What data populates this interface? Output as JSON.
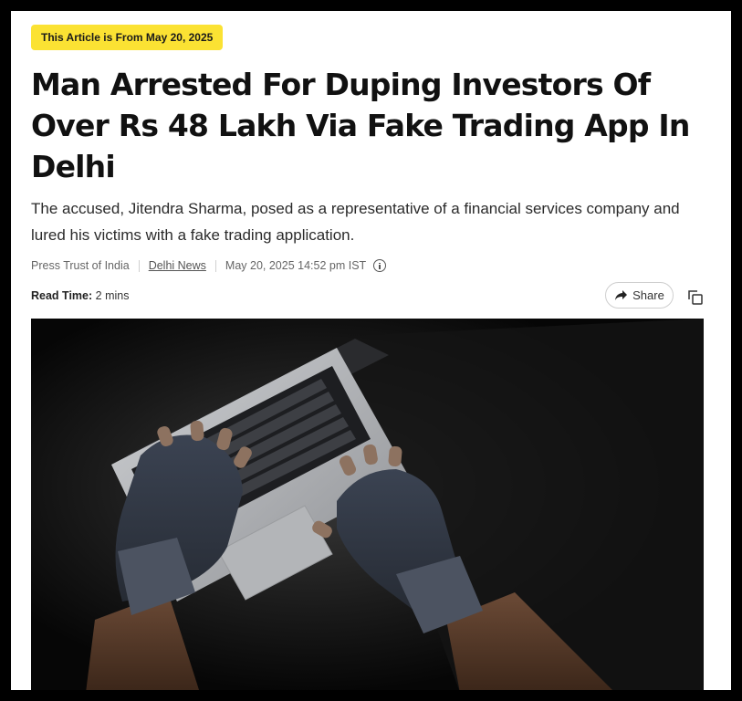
{
  "article": {
    "date_badge": "This Article is From May 20, 2025",
    "headline": "Man Arrested For Duping Investors Of Over Rs 48 Lakh Via Fake Trading App In Delhi",
    "summary": "The accused, Jitendra Sharma, posed as a representative of a financial services company and lured his victims with a fake trading application.",
    "meta": {
      "source": "Press Trust of India",
      "category": "Delhi News",
      "datetime": "May 20, 2025 14:52 pm IST",
      "info_icon": "info-circle-icon"
    },
    "read_time": {
      "label": "Read Time:",
      "value": "2 mins"
    },
    "actions": {
      "share_label": "Share",
      "share_icon": "share-arrow-icon",
      "copy_icon": "copy-icon"
    },
    "colors": {
      "badge_bg": "#fbe233",
      "headline": "#111111",
      "frame": "#000000"
    }
  }
}
